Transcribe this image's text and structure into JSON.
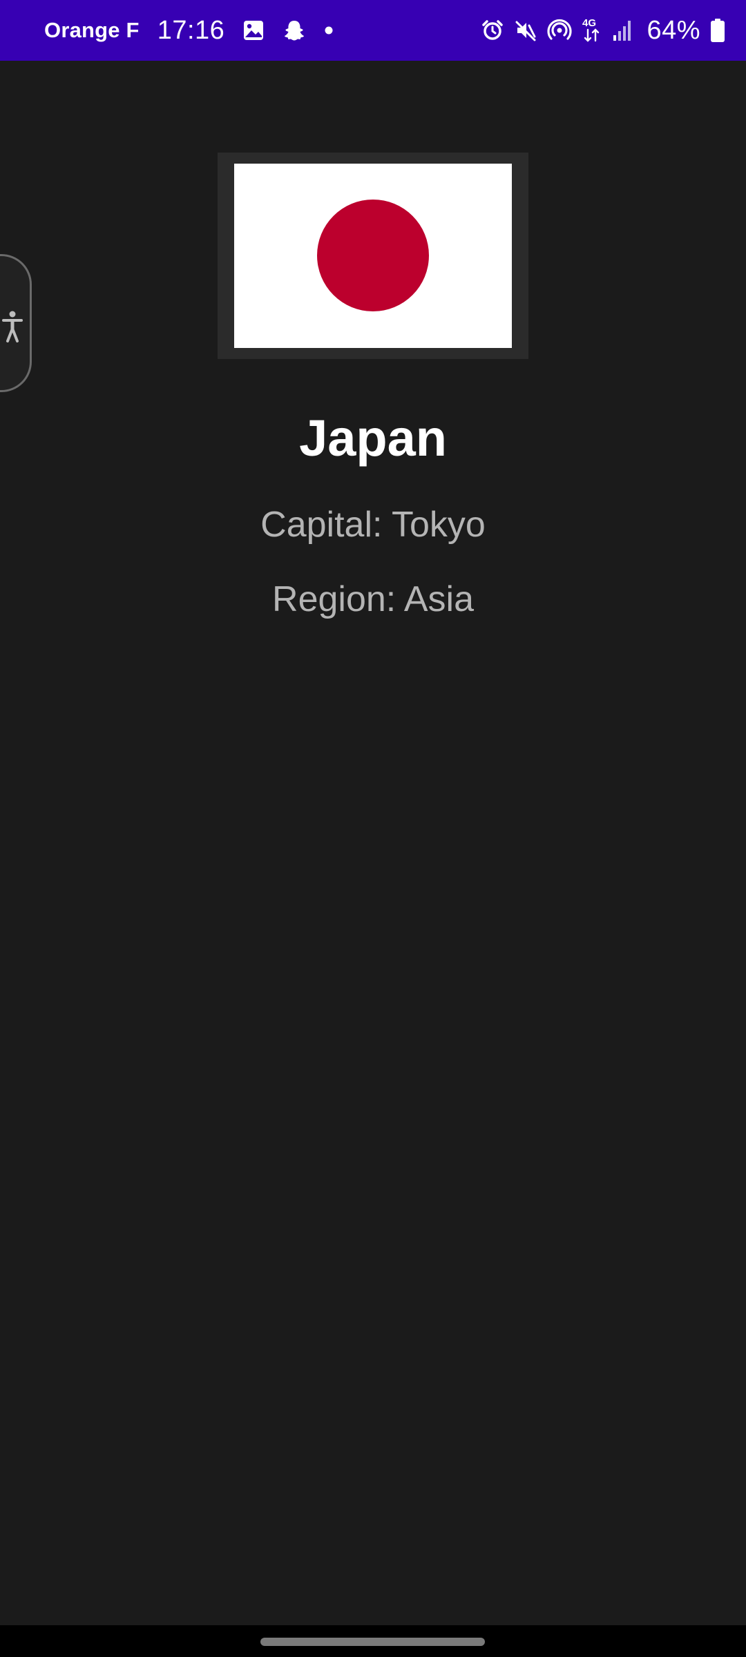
{
  "status_bar": {
    "carrier": "Orange F",
    "time": "17:16",
    "network": "4G",
    "battery_percent": "64%",
    "background_color": "#3700b3",
    "left_icons": [
      "gallery-icon",
      "snapchat-icon",
      "notification-dot-icon"
    ],
    "right_icons": [
      "alarm-icon",
      "mute-icon",
      "hotspot-icon",
      "network-4g-icon",
      "signal-icon",
      "battery-icon"
    ]
  },
  "country": {
    "name": "Japan",
    "capital_line": "Capital: Tokyo",
    "region_line": "Region: Asia",
    "flag": {
      "description_icon": "japan-flag",
      "field_color": "#ffffff",
      "disc_color": "#bc002d"
    }
  },
  "accessibility_tab": {
    "icon": "accessibility-icon"
  },
  "theme": {
    "background": "#1b1b1b",
    "title_color": "#ffffff",
    "text_color": "#b4b4b4"
  }
}
